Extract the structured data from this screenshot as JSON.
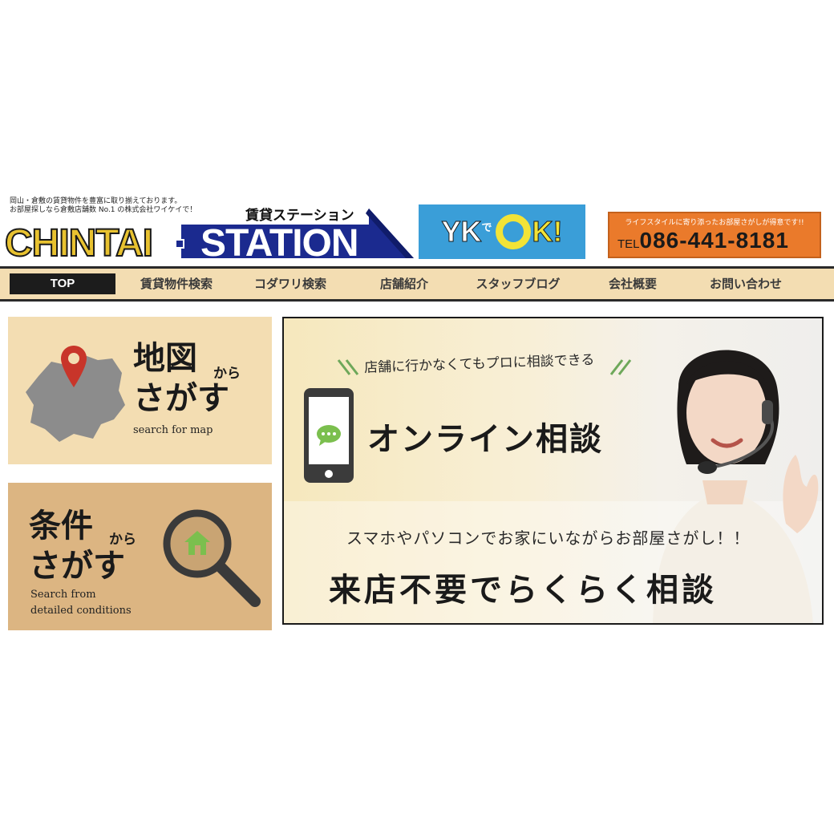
{
  "header": {
    "tagline_1": "岡山・倉敷の賃貸物件を豊富に取り揃えております。",
    "tagline_2": "お部屋探しなら倉敷店舗数 No.1 の株式会社ワイケイで！",
    "logo_left": "CHINTAI",
    "logo_right": "STATION",
    "logo_jp": "賃貸ステーション",
    "ykok": {
      "yk": "YK",
      "de": "で",
      "k": "K!"
    },
    "tel": {
      "note": "ライフスタイルに寄り添ったお部屋さがしが得意です!!",
      "prefix": "TEL",
      "number": "086-441-8181"
    }
  },
  "nav": {
    "items": [
      "TOP",
      "賃貸物件検索",
      "コダワリ検索",
      "店舗紹介",
      "スタッフブログ",
      "会社概要",
      "お問い合わせ"
    ],
    "active": "TOP"
  },
  "search_cards": {
    "map": {
      "title_1": "地図",
      "small": "から",
      "title_2": "さがす",
      "sub": "search for map"
    },
    "conditions": {
      "title_1": "条件",
      "small": "から",
      "title_2": "さがす",
      "sub_1": "Search from",
      "sub_2": "detailed conditions"
    }
  },
  "banner": {
    "subtitle": "店舗に行かなくてもプロに相談できる",
    "title": "オンライン相談",
    "line1": "スマホやパソコンでお家にいながらお部屋さがし！！",
    "line2": "来店不要でらくらく相談"
  },
  "colors": {
    "nav_bg": "#f3ddb2",
    "logo_yellow": "#e8c230",
    "logo_blue": "#1b2a8f",
    "ykok_blue": "#3a9ed8",
    "tel_orange": "#ea7a2b",
    "map_card_bg": "#f3ddb2",
    "cond_card_bg": "#dcb582"
  },
  "icons": [
    "map-pin-icon",
    "okayama-map-icon",
    "magnifier-icon",
    "house-icon",
    "smartphone-icon",
    "chat-bubble-icon"
  ]
}
